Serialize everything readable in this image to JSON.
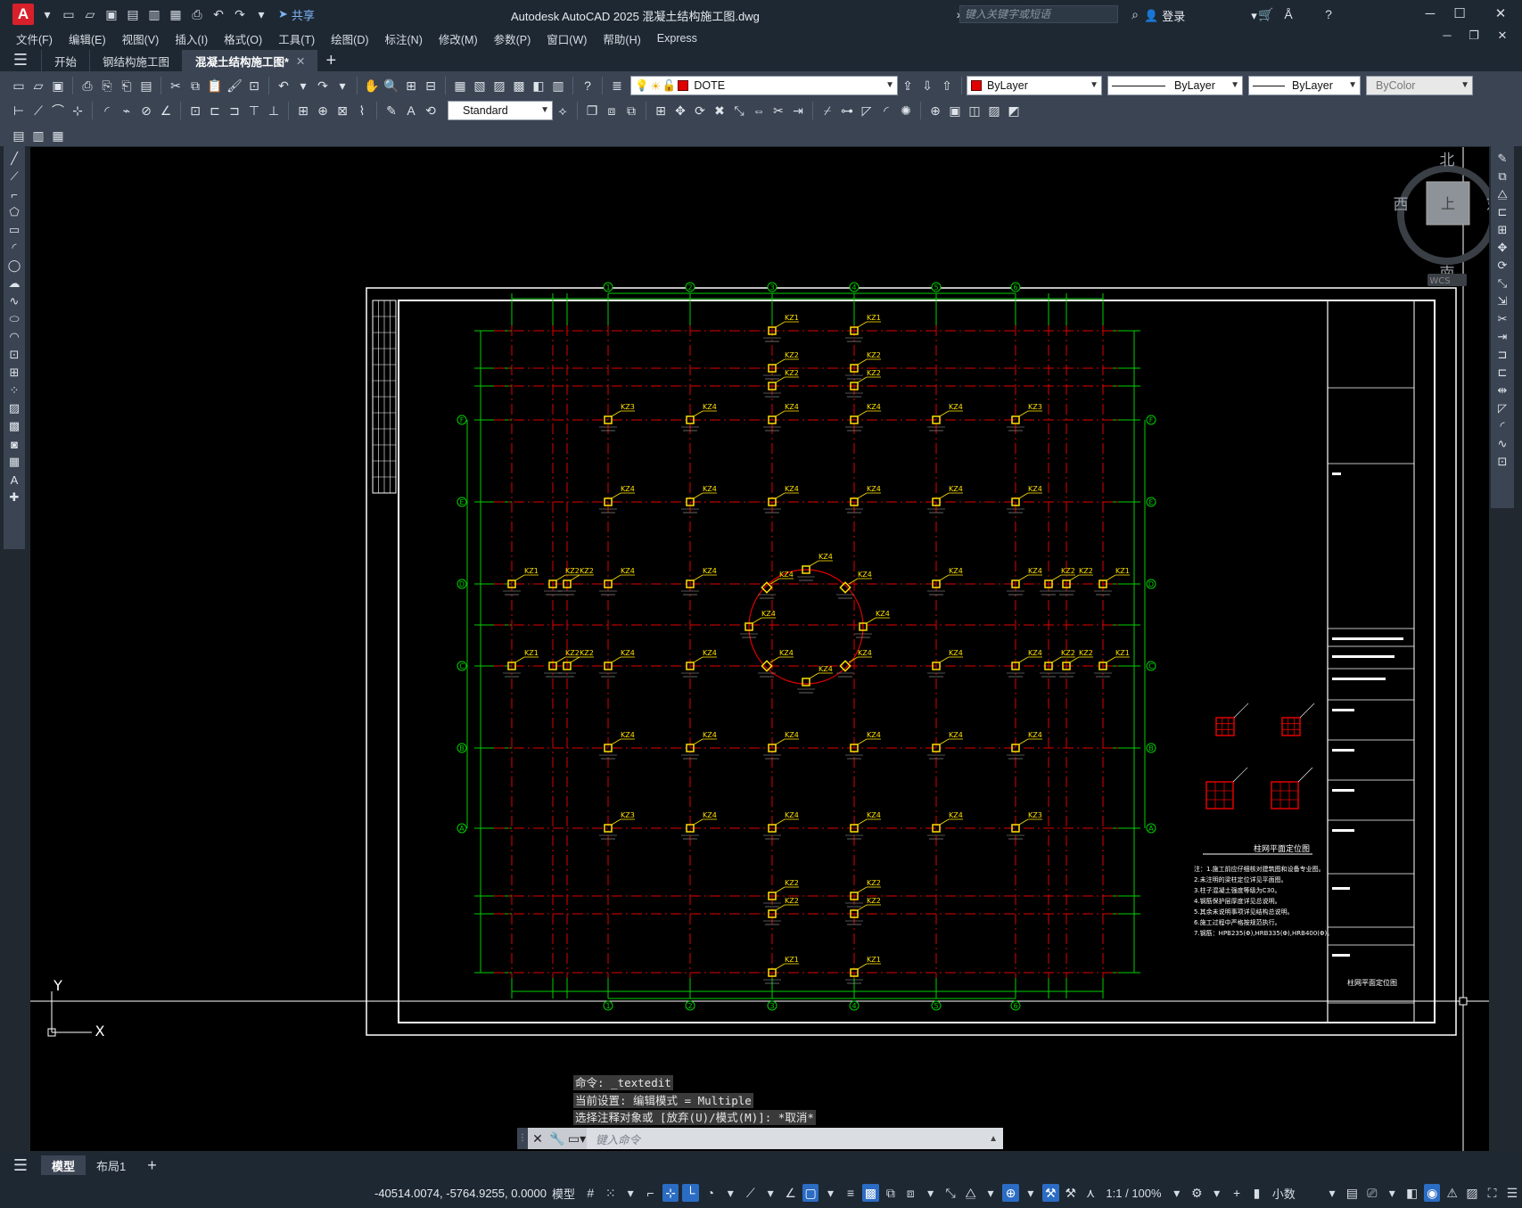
{
  "app": {
    "logo_letter": "A",
    "title": "Autodesk AutoCAD 2025    混凝土结构施工图.dwg",
    "share_label": "共享",
    "search_placeholder": "键入关键字或短语",
    "login_label": "登录"
  },
  "menu": [
    "文件(F)",
    "编辑(E)",
    "视图(V)",
    "插入(I)",
    "格式(O)",
    "工具(T)",
    "绘图(D)",
    "标注(N)",
    "修改(M)",
    "参数(P)",
    "窗口(W)",
    "帮助(H)",
    "Express"
  ],
  "tabs": [
    {
      "label": "开始",
      "active": false
    },
    {
      "label": "钢结构施工图",
      "active": false
    },
    {
      "label": "混凝土结构施工图*",
      "active": true
    }
  ],
  "toolbar": {
    "layer_name": "DOTE",
    "color": "ByLayer",
    "linetype": "ByLayer",
    "lineweight": "ByLayer",
    "plotstyle": "ByColor",
    "dimstyle": "Standard"
  },
  "viewcube": {
    "north": "北",
    "south": "南",
    "east": "东",
    "west": "西",
    "face": "上",
    "wcs": "WCS"
  },
  "ucs": {
    "x": "X",
    "y": "Y"
  },
  "command": {
    "history": [
      "命令: _textedit",
      "当前设置: 编辑模式 = Multiple",
      "选择注释对象或 [放弃(U)/模式(M)]: *取消*"
    ],
    "placeholder": "键入命令"
  },
  "layout_tabs": [
    {
      "label": "模型",
      "active": true
    },
    {
      "label": "布局1",
      "active": false
    }
  ],
  "status": {
    "coordinates": "-40514.0074, -5764.9255, 0.0000",
    "model": "模型",
    "scale": "1:1 / 100%",
    "units": "小数"
  },
  "drawing": {
    "plan_title": "柱网平面定位图",
    "column_labels": [
      "KZ1",
      "KZ2",
      "KZ3",
      "KZ4"
    ],
    "axis_numbers": [
      "1",
      "2",
      "3",
      "4",
      "5",
      "6"
    ],
    "axis_letters": [
      "A",
      "B",
      "C",
      "D",
      "E",
      "F"
    ],
    "notes": [
      "注：1.施工前应仔细核对建筑图和设备专业图。",
      "2.未注明的梁柱定位详见平面图。",
      "3.柱子混凝土强度等级为C30。",
      "4.钢筋保护层厚度详见总说明。",
      "5.其余未说明事项详见结构总说明。",
      "6.施工过程中严格按规范执行。",
      "7.钢筋：HPB235(Φ),HRB335(Φ),HRB400(Φ)。"
    ],
    "titleblock_name": "柱网平面定位图"
  }
}
